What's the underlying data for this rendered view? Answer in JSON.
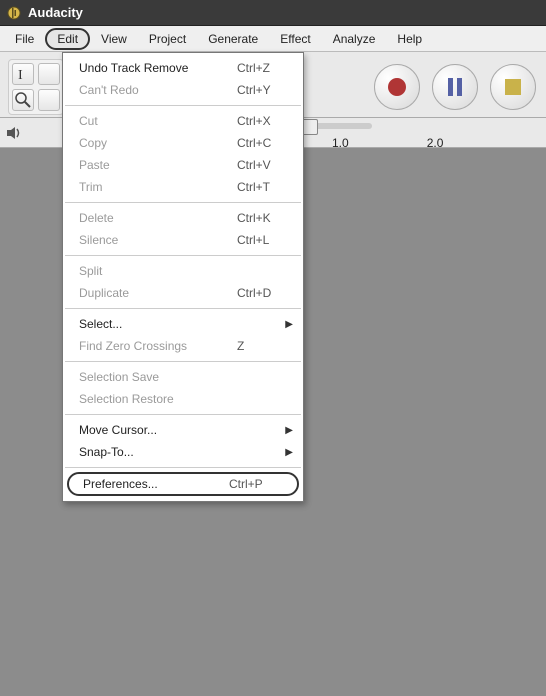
{
  "window": {
    "title": "Audacity"
  },
  "menubar": {
    "items": [
      {
        "label": "File"
      },
      {
        "label": "Edit"
      },
      {
        "label": "View"
      },
      {
        "label": "Project"
      },
      {
        "label": "Generate"
      },
      {
        "label": "Effect"
      },
      {
        "label": "Analyze"
      },
      {
        "label": "Help"
      }
    ],
    "open_index": 1
  },
  "ruler": {
    "ticks": [
      "1.0",
      "2.0"
    ]
  },
  "edit_menu": {
    "groups": [
      [
        {
          "label": "Undo Track Remove",
          "shortcut": "Ctrl+Z",
          "enabled": true
        },
        {
          "label": "Can't Redo",
          "shortcut": "Ctrl+Y",
          "enabled": false
        }
      ],
      [
        {
          "label": "Cut",
          "shortcut": "Ctrl+X",
          "enabled": false
        },
        {
          "label": "Copy",
          "shortcut": "Ctrl+C",
          "enabled": false
        },
        {
          "label": "Paste",
          "shortcut": "Ctrl+V",
          "enabled": false
        },
        {
          "label": "Trim",
          "shortcut": "Ctrl+T",
          "enabled": false
        }
      ],
      [
        {
          "label": "Delete",
          "shortcut": "Ctrl+K",
          "enabled": false
        },
        {
          "label": "Silence",
          "shortcut": "Ctrl+L",
          "enabled": false
        }
      ],
      [
        {
          "label": "Split",
          "shortcut": "",
          "enabled": false
        },
        {
          "label": "Duplicate",
          "shortcut": "Ctrl+D",
          "enabled": false
        }
      ],
      [
        {
          "label": "Select...",
          "shortcut": "",
          "enabled": true,
          "submenu": true
        },
        {
          "label": "Find Zero Crossings",
          "shortcut": "Z",
          "enabled": false
        }
      ],
      [
        {
          "label": "Selection Save",
          "shortcut": "",
          "enabled": false
        },
        {
          "label": "Selection Restore",
          "shortcut": "",
          "enabled": false
        }
      ],
      [
        {
          "label": "Move Cursor...",
          "shortcut": "",
          "enabled": true,
          "submenu": true
        },
        {
          "label": "Snap-To...",
          "shortcut": "",
          "enabled": true,
          "submenu": true
        }
      ],
      [
        {
          "label": "Preferences...",
          "shortcut": "Ctrl+P",
          "enabled": true,
          "highlighted": true
        }
      ]
    ]
  }
}
